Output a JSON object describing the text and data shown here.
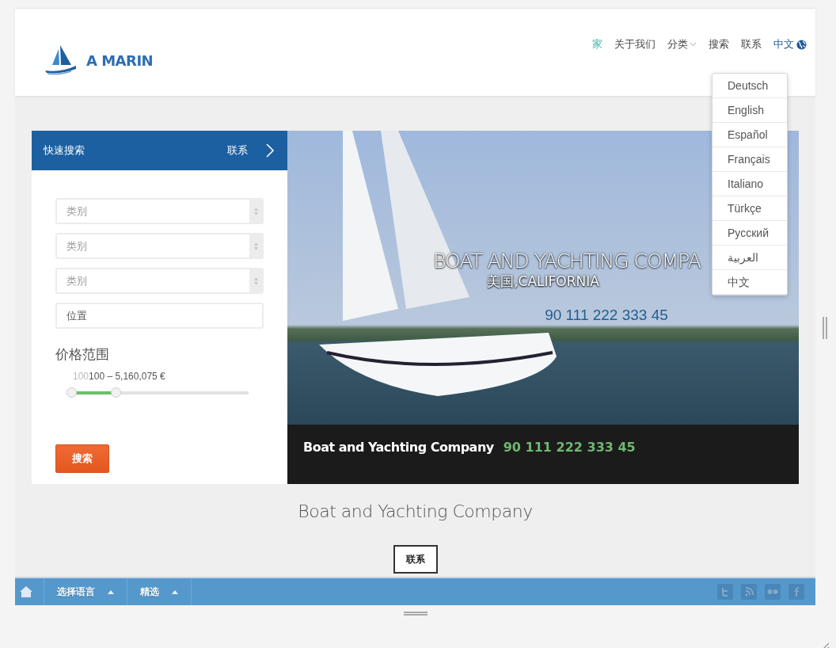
{
  "logo": {
    "text": "A MARIN"
  },
  "nav": [
    {
      "label": "家",
      "selected": true,
      "kind": "link"
    },
    {
      "label": "关于我们",
      "selected": false,
      "kind": "link"
    },
    {
      "label": "分类",
      "selected": false,
      "kind": "dropdown"
    },
    {
      "label": "搜索",
      "selected": false,
      "kind": "link"
    },
    {
      "label": "联系",
      "selected": false,
      "kind": "link"
    },
    {
      "label": "中文",
      "selected": false,
      "kind": "language"
    }
  ],
  "language_menu": [
    "Deutsch",
    "English",
    "Español",
    "Français",
    "Italiano",
    "Türkçe",
    "Русский",
    "العربية",
    "中文"
  ],
  "quick_search": {
    "title": "快速搜索",
    "contact_link": "联系",
    "selects": [
      {
        "placeholder": "类别"
      },
      {
        "placeholder": "类别"
      },
      {
        "placeholder": "类别"
      }
    ],
    "location": {
      "placeholder": "位置"
    },
    "price_title": "价格范围",
    "price_min_label": "100",
    "price_range": "100 – 5,160,075 €",
    "level": 0.26,
    "button": "搜索"
  },
  "slide": {
    "title": "BOAT AND YACHTING COMPA",
    "subtitle": "美国,CALIFORNIA",
    "phone": "90 111 222 333 45",
    "caption_name": "Boat and Yachting Company",
    "caption_phone": "90 111 222 333 45"
  },
  "company_title": "Boat and Yachting Company",
  "contact_button": "联系",
  "bottom_bar": {
    "items": [
      {
        "label": "选择语言"
      },
      {
        "label": "精选"
      }
    ]
  }
}
